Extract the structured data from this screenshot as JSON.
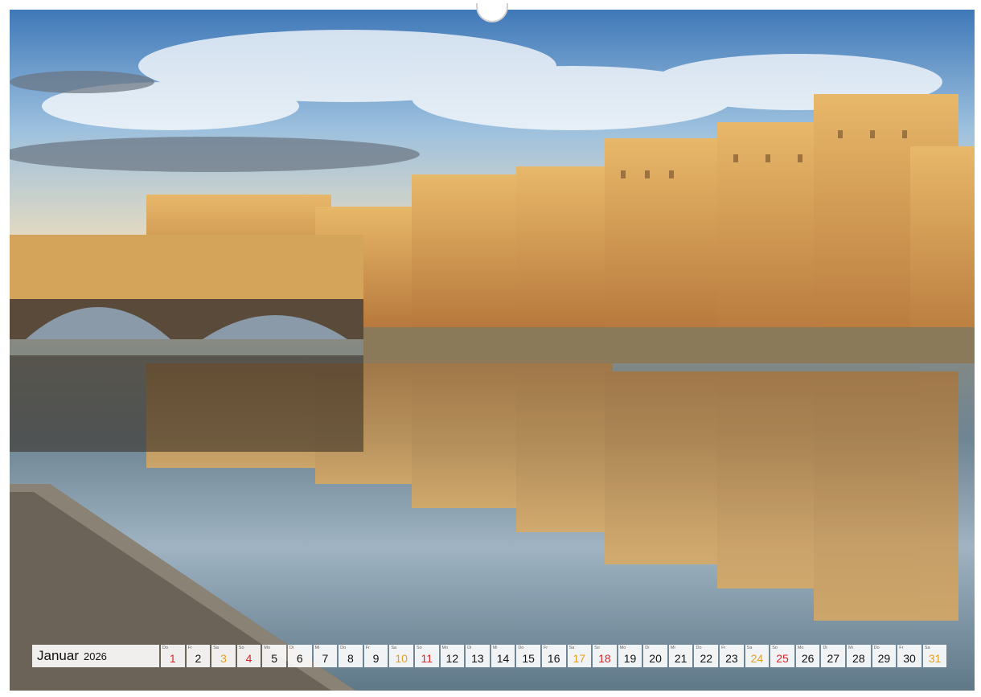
{
  "calendar": {
    "month": "Januar",
    "year": "2026",
    "days": [
      {
        "n": "1",
        "wd": "Do",
        "type": "hol"
      },
      {
        "n": "2",
        "wd": "Fr",
        "type": ""
      },
      {
        "n": "3",
        "wd": "Sa",
        "type": "sat"
      },
      {
        "n": "4",
        "wd": "So",
        "type": "sun"
      },
      {
        "n": "5",
        "wd": "Mo",
        "type": ""
      },
      {
        "n": "6",
        "wd": "Di",
        "type": ""
      },
      {
        "n": "7",
        "wd": "Mi",
        "type": ""
      },
      {
        "n": "8",
        "wd": "Do",
        "type": ""
      },
      {
        "n": "9",
        "wd": "Fr",
        "type": ""
      },
      {
        "n": "10",
        "wd": "Sa",
        "type": "sat"
      },
      {
        "n": "11",
        "wd": "So",
        "type": "sun"
      },
      {
        "n": "12",
        "wd": "Mo",
        "type": ""
      },
      {
        "n": "13",
        "wd": "Di",
        "type": ""
      },
      {
        "n": "14",
        "wd": "Mi",
        "type": ""
      },
      {
        "n": "15",
        "wd": "Do",
        "type": ""
      },
      {
        "n": "16",
        "wd": "Fr",
        "type": ""
      },
      {
        "n": "17",
        "wd": "Sa",
        "type": "sat"
      },
      {
        "n": "18",
        "wd": "So",
        "type": "sun"
      },
      {
        "n": "19",
        "wd": "Mo",
        "type": ""
      },
      {
        "n": "20",
        "wd": "Di",
        "type": ""
      },
      {
        "n": "21",
        "wd": "Mi",
        "type": ""
      },
      {
        "n": "22",
        "wd": "Do",
        "type": ""
      },
      {
        "n": "23",
        "wd": "Fr",
        "type": ""
      },
      {
        "n": "24",
        "wd": "Sa",
        "type": "sat"
      },
      {
        "n": "25",
        "wd": "So",
        "type": "sun"
      },
      {
        "n": "26",
        "wd": "Mo",
        "type": ""
      },
      {
        "n": "27",
        "wd": "Di",
        "type": ""
      },
      {
        "n": "28",
        "wd": "Mi",
        "type": ""
      },
      {
        "n": "29",
        "wd": "Do",
        "type": ""
      },
      {
        "n": "30",
        "wd": "Fr",
        "type": ""
      },
      {
        "n": "31",
        "wd": "Sa",
        "type": "sat"
      }
    ]
  },
  "colors": {
    "saturday": "#e2a020",
    "sunday_holiday": "#d9252a"
  }
}
